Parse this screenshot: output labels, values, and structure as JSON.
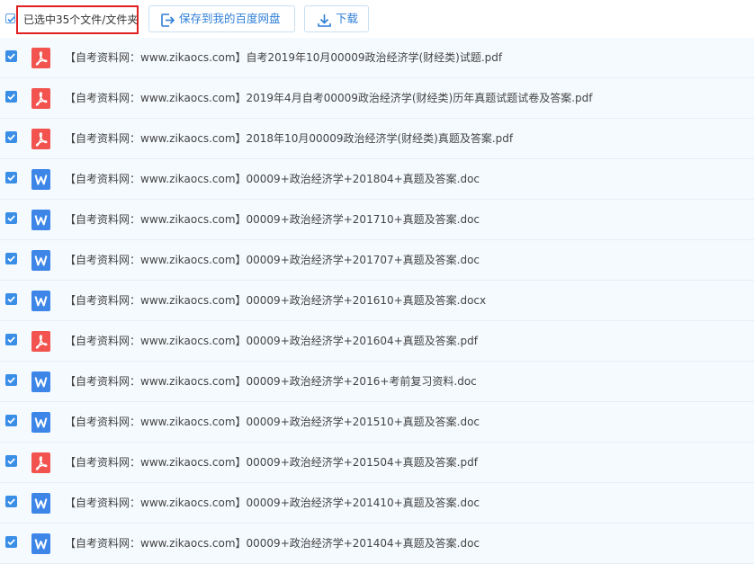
{
  "toolbar": {
    "selected_label": "已选中35个文件/文件夹",
    "save_label": "保存到我的百度网盘",
    "download_label": "下载"
  },
  "colors": {
    "accent": "#2f7fd7",
    "checkbox": "#3a8ee6",
    "highlight_border": "#e02020",
    "pdf_icon": "#f2534f",
    "word_icon": "#3d86e8",
    "row_bg": "#f5fafe"
  },
  "files": [
    {
      "name": "【自考资料网：www.zikaocs.com】自考2019年10月00009政治经济学(财经类)试题.pdf",
      "type": "pdf",
      "icon": "pdf-icon"
    },
    {
      "name": "【自考资料网：www.zikaocs.com】2019年4月自考00009政治经济学(财经类)历年真题试题试卷及答案.pdf",
      "type": "pdf",
      "icon": "pdf-icon"
    },
    {
      "name": "【自考资料网：www.zikaocs.com】2018年10月00009政治经济学(财经类)真题及答案.pdf",
      "type": "pdf",
      "icon": "pdf-icon"
    },
    {
      "name": "【自考资料网：www.zikaocs.com】00009+政治经济学+201804+真题及答案.doc",
      "type": "word",
      "icon": "word-icon"
    },
    {
      "name": "【自考资料网：www.zikaocs.com】00009+政治经济学+201710+真题及答案.doc",
      "type": "word",
      "icon": "word-icon"
    },
    {
      "name": "【自考资料网：www.zikaocs.com】00009+政治经济学+201707+真题及答案.doc",
      "type": "word",
      "icon": "word-icon"
    },
    {
      "name": "【自考资料网：www.zikaocs.com】00009+政治经济学+201610+真题及答案.docx",
      "type": "word",
      "icon": "word-icon"
    },
    {
      "name": "【自考资料网：www.zikaocs.com】00009+政治经济学+201604+真题及答案.pdf",
      "type": "pdf",
      "icon": "pdf-icon"
    },
    {
      "name": "【自考资料网：www.zikaocs.com】00009+政治经济学+2016+考前复习资料.doc",
      "type": "word",
      "icon": "word-icon"
    },
    {
      "name": "【自考资料网：www.zikaocs.com】00009+政治经济学+201510+真题及答案.doc",
      "type": "word",
      "icon": "word-icon"
    },
    {
      "name": "【自考资料网：www.zikaocs.com】00009+政治经济学+201504+真题及答案.pdf",
      "type": "pdf",
      "icon": "pdf-icon"
    },
    {
      "name": "【自考资料网：www.zikaocs.com】00009+政治经济学+201410+真题及答案.doc",
      "type": "word",
      "icon": "word-icon"
    },
    {
      "name": "【自考资料网：www.zikaocs.com】00009+政治经济学+201404+真题及答案.doc",
      "type": "word",
      "icon": "word-icon"
    }
  ]
}
